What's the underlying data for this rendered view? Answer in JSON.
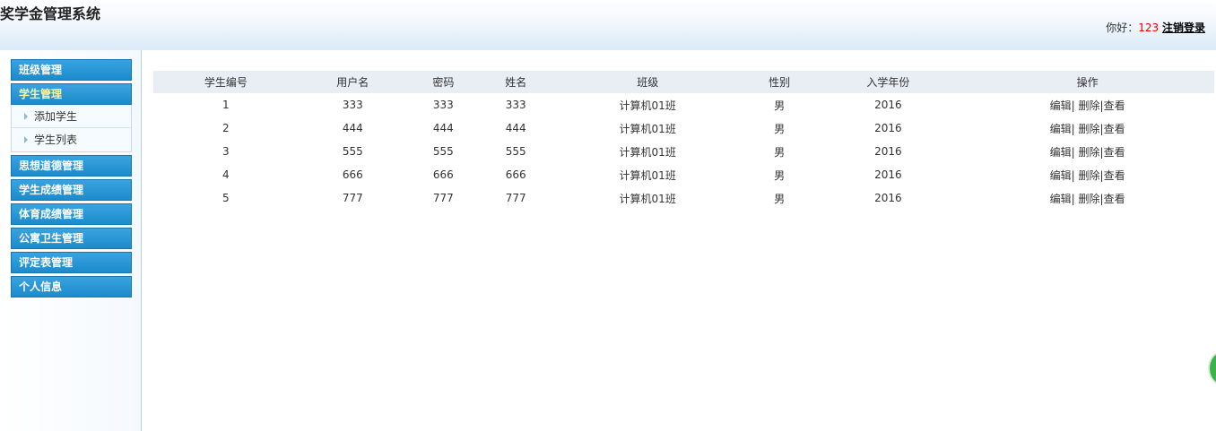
{
  "header": {
    "title": "奖学金管理系统",
    "greeting": "你好：",
    "username": "123",
    "logout": "注销登录"
  },
  "sidebar": {
    "items": [
      {
        "label": "班级管理"
      },
      {
        "label": "学生管理",
        "sub": [
          "添加学生",
          "学生列表"
        ]
      },
      {
        "label": "思想道德管理"
      },
      {
        "label": "学生成绩管理"
      },
      {
        "label": "体育成绩管理"
      },
      {
        "label": "公寓卫生管理"
      },
      {
        "label": "评定表管理"
      },
      {
        "label": "个人信息"
      }
    ]
  },
  "table": {
    "headers": [
      "学生编号",
      "用户名",
      "密码",
      "姓名",
      "班级",
      "性别",
      "入学年份",
      "操作"
    ],
    "rows": [
      [
        "1",
        "333",
        "333",
        "333",
        "计算机01班",
        "男",
        "2016"
      ],
      [
        "2",
        "444",
        "444",
        "444",
        "计算机01班",
        "男",
        "2016"
      ],
      [
        "3",
        "555",
        "555",
        "555",
        "计算机01班",
        "男",
        "2016"
      ],
      [
        "4",
        "666",
        "666",
        "666",
        "计算机01班",
        "男",
        "2016"
      ],
      [
        "5",
        "777",
        "777",
        "777",
        "计算机01班",
        "男",
        "2016"
      ]
    ],
    "ops": {
      "edit": "编辑",
      "sep1": "| ",
      "delete": "删除",
      "sep2": "|",
      "view": "查看"
    }
  }
}
